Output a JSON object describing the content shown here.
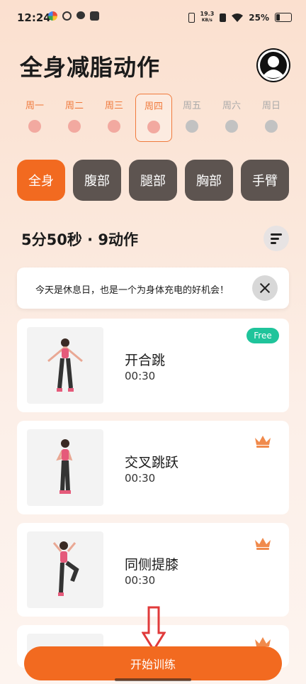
{
  "status_bar": {
    "time": "12:24",
    "net_speed_value": "19.3",
    "net_speed_unit": "KB/s",
    "battery": "25%"
  },
  "header": {
    "title": "全身减脂动作"
  },
  "week": [
    {
      "label": "周一",
      "state": "done"
    },
    {
      "label": "周二",
      "state": "done"
    },
    {
      "label": "周三",
      "state": "done"
    },
    {
      "label": "周四",
      "state": "today"
    },
    {
      "label": "周五",
      "state": "future"
    },
    {
      "label": "周六",
      "state": "future"
    },
    {
      "label": "周日",
      "state": "future"
    }
  ],
  "categories": [
    {
      "label": "全身",
      "active": true
    },
    {
      "label": "腹部",
      "active": false
    },
    {
      "label": "腿部",
      "active": false
    },
    {
      "label": "胸部",
      "active": false
    },
    {
      "label": "手臂",
      "active": false
    }
  ],
  "summary": {
    "text": "5分50秒 · 9动作"
  },
  "notice": {
    "text": "今天是休息日，也是一个为身体充电的好机会！"
  },
  "exercises": [
    {
      "name": "开合跳",
      "duration": "00:30",
      "badge": "Free"
    },
    {
      "name": "交叉跳跃",
      "duration": "00:30",
      "badge": "crown"
    },
    {
      "name": "同侧提膝",
      "duration": "00:30",
      "badge": "crown"
    }
  ],
  "footer": {
    "start_label": "开始训练"
  },
  "colors": {
    "accent": "#f26a20",
    "category_inactive": "#5d5450",
    "free_badge": "#1fc49b",
    "crown": "#f08a4c",
    "arrow": "#e03a3a"
  }
}
